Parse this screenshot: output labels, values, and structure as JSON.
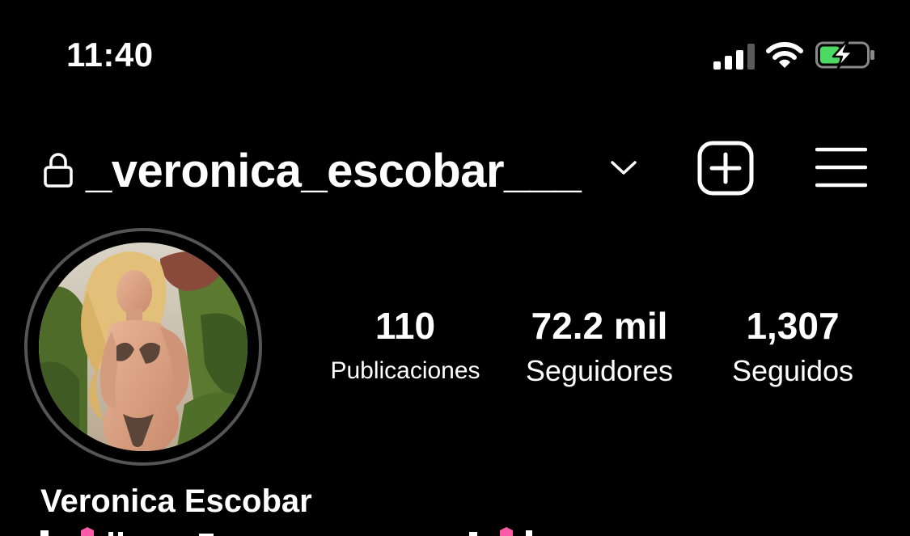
{
  "status_bar": {
    "time": "11:40",
    "icons": [
      "cellular-signal-icon",
      "wifi-icon",
      "battery-charging-icon"
    ],
    "battery_color": "#4cd964"
  },
  "header": {
    "username": "_veronica_escobar___",
    "icons": [
      "lock-icon",
      "chevron-down-icon",
      "add-post-icon",
      "menu-icon"
    ]
  },
  "profile": {
    "display_name": "Veronica Escobar",
    "stats": [
      {
        "value": "110",
        "label": "Publicaciones"
      },
      {
        "value": "72.2 mil",
        "label": "Seguidores"
      },
      {
        "value": "1,307",
        "label": "Seguidos"
      }
    ]
  },
  "colors": {
    "background": "#000000",
    "text": "#ffffff",
    "avatar_ring": "#555555"
  }
}
